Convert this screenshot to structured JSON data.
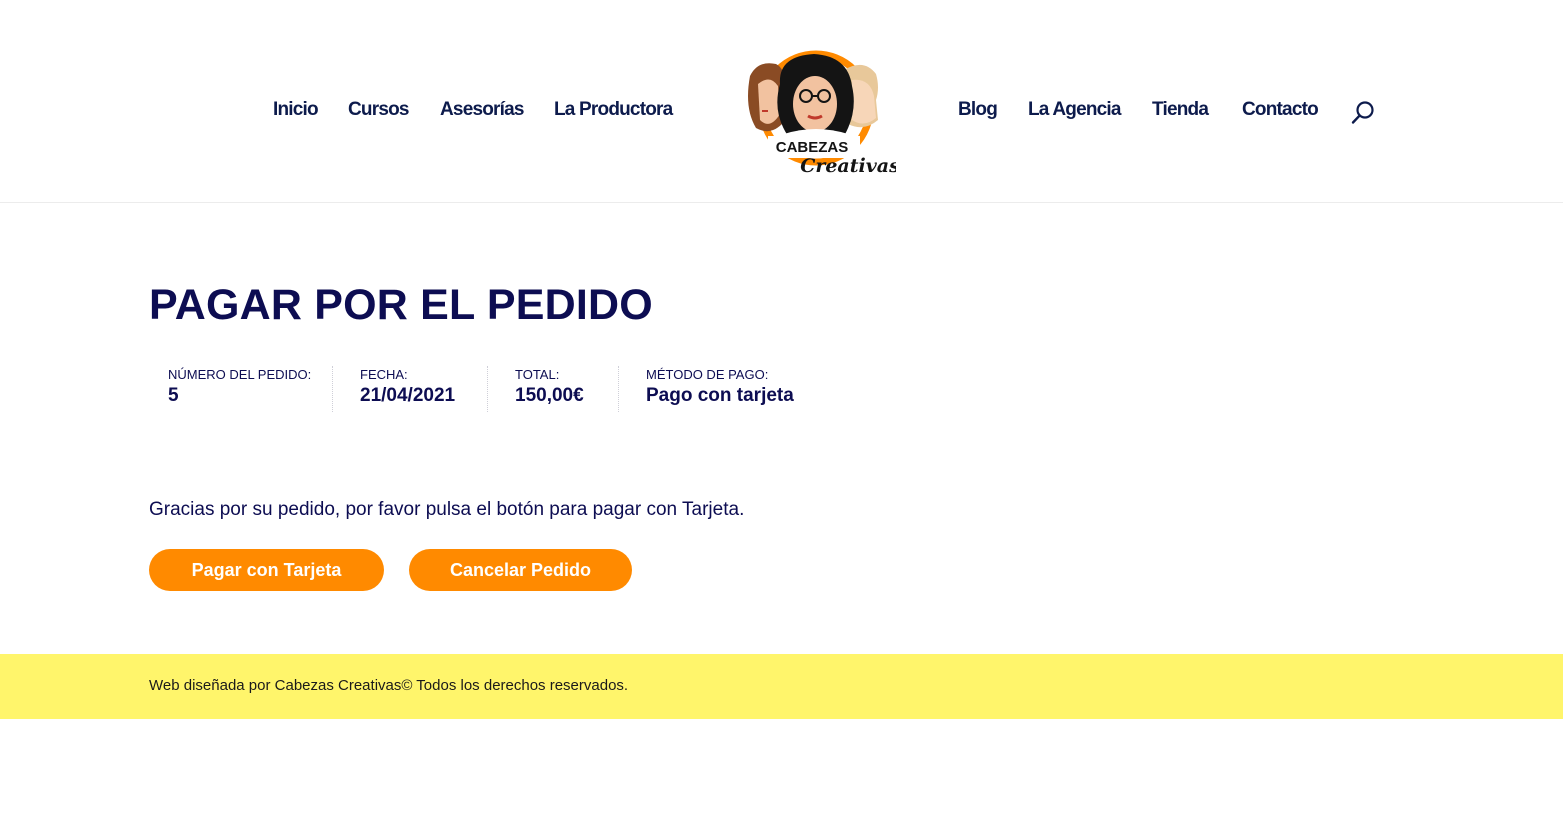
{
  "nav_left": [
    {
      "label": "Inicio"
    },
    {
      "label": "Cursos"
    },
    {
      "label": "Asesorías"
    },
    {
      "label": "La Productora"
    }
  ],
  "nav_right": [
    {
      "label": "Blog"
    },
    {
      "label": "La Agencia"
    },
    {
      "label": "Tienda"
    },
    {
      "label": "Contacto"
    }
  ],
  "logo": {
    "line1": "CABEZAS",
    "line2": "Creativas"
  },
  "icons": {
    "search": "search-icon"
  },
  "page": {
    "title": "PAGAR POR EL PEDIDO"
  },
  "order": {
    "number_label": "Número del pedido:",
    "number_value": "5",
    "date_label": "Fecha:",
    "date_value": "21/04/2021",
    "total_label": "Total:",
    "total_value": "150,00€",
    "method_label": "Método de pago:",
    "method_value": "Pago con tarjeta"
  },
  "message": "Gracias por su pedido, por favor pulsa el botón para pagar con Tarjeta.",
  "buttons": {
    "pay": "Pagar con Tarjeta",
    "cancel": "Cancelar Pedido"
  },
  "footer": {
    "text": "Web diseñada por Cabezas Creativas© Todos los derechos reservados."
  },
  "colors": {
    "accent": "#ff8a00",
    "text": "#0d0d52",
    "footer_bg": "#fff56b"
  }
}
